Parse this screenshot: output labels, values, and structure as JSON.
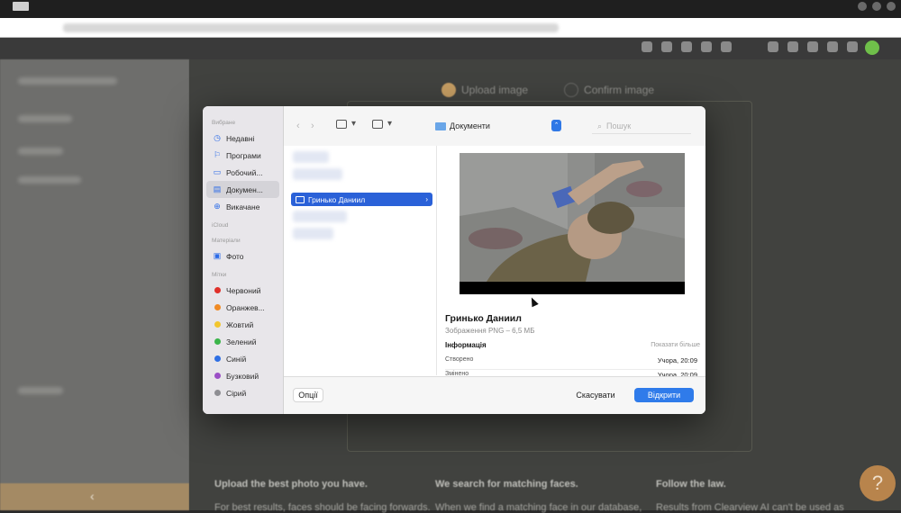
{
  "page": {
    "steps": [
      {
        "label": "Upload image"
      },
      {
        "label": "Confirm image"
      }
    ],
    "info": [
      {
        "title": "Upload the best photo you have.",
        "body": "For best results, faces should be facing forwards."
      },
      {
        "title": "We search for matching faces.",
        "body": "When we find a matching face in our database,"
      },
      {
        "title": "Follow the law.",
        "body": "Results from Clearview AI can't be used as"
      }
    ],
    "back_glyph": "‹",
    "help_glyph": "?"
  },
  "dialog": {
    "sidebar": {
      "favorites_header": "Вибране",
      "favorites": [
        {
          "label": "Недавні",
          "icon": "clock-icon",
          "glyph": "◷"
        },
        {
          "label": "Програми",
          "icon": "apps-icon",
          "glyph": "⚐"
        },
        {
          "label": "Робочий...",
          "icon": "desktop-icon",
          "glyph": "▭"
        },
        {
          "label": "Докумен...",
          "icon": "document-icon",
          "glyph": "▤",
          "selected": true
        },
        {
          "label": "Викачане",
          "icon": "download-icon",
          "glyph": "⊕"
        }
      ],
      "icloud_header": "iCloud",
      "locations_header": "Матеріали",
      "locations": [
        {
          "label": "Фото",
          "icon": "photos-icon",
          "glyph": "▣"
        }
      ],
      "tags_header": "Мітки",
      "tags": [
        {
          "label": "Червоний",
          "color": "#e0302a"
        },
        {
          "label": "Оранжев...",
          "color": "#f08a24"
        },
        {
          "label": "Жовтий",
          "color": "#f2c62e"
        },
        {
          "label": "Зелений",
          "color": "#3bb54a"
        },
        {
          "label": "Синій",
          "color": "#2f6fe4"
        },
        {
          "label": "Бузковий",
          "color": "#9b4fc6"
        },
        {
          "label": "Сірий",
          "color": "#8e8e93"
        }
      ]
    },
    "toolbar": {
      "back": "‹",
      "forward": "›",
      "location": "Документи",
      "chevron": "⌃",
      "search_placeholder": "Пошук",
      "search_glyph": "⌕"
    },
    "file_list": {
      "selected": "Гринько Даниил",
      "arrow": "›"
    },
    "preview": {
      "name": "Гринько Даниил",
      "type": "Зображення PNG – 6,5 МБ",
      "info_header": "Інформація",
      "more": "Показати більше",
      "rows": [
        {
          "label": "Створено",
          "value": "Учора, 20:09"
        },
        {
          "label": "Змінено",
          "value": "Учора, 20:09"
        }
      ]
    },
    "buttons": {
      "options": "Опції",
      "cancel": "Скасувати",
      "open": "Відкрити"
    }
  },
  "colors": {
    "accent": "#2f7bea",
    "selection": "#2a61d8",
    "backdrop": "#41423f",
    "help": "#b8844c"
  }
}
